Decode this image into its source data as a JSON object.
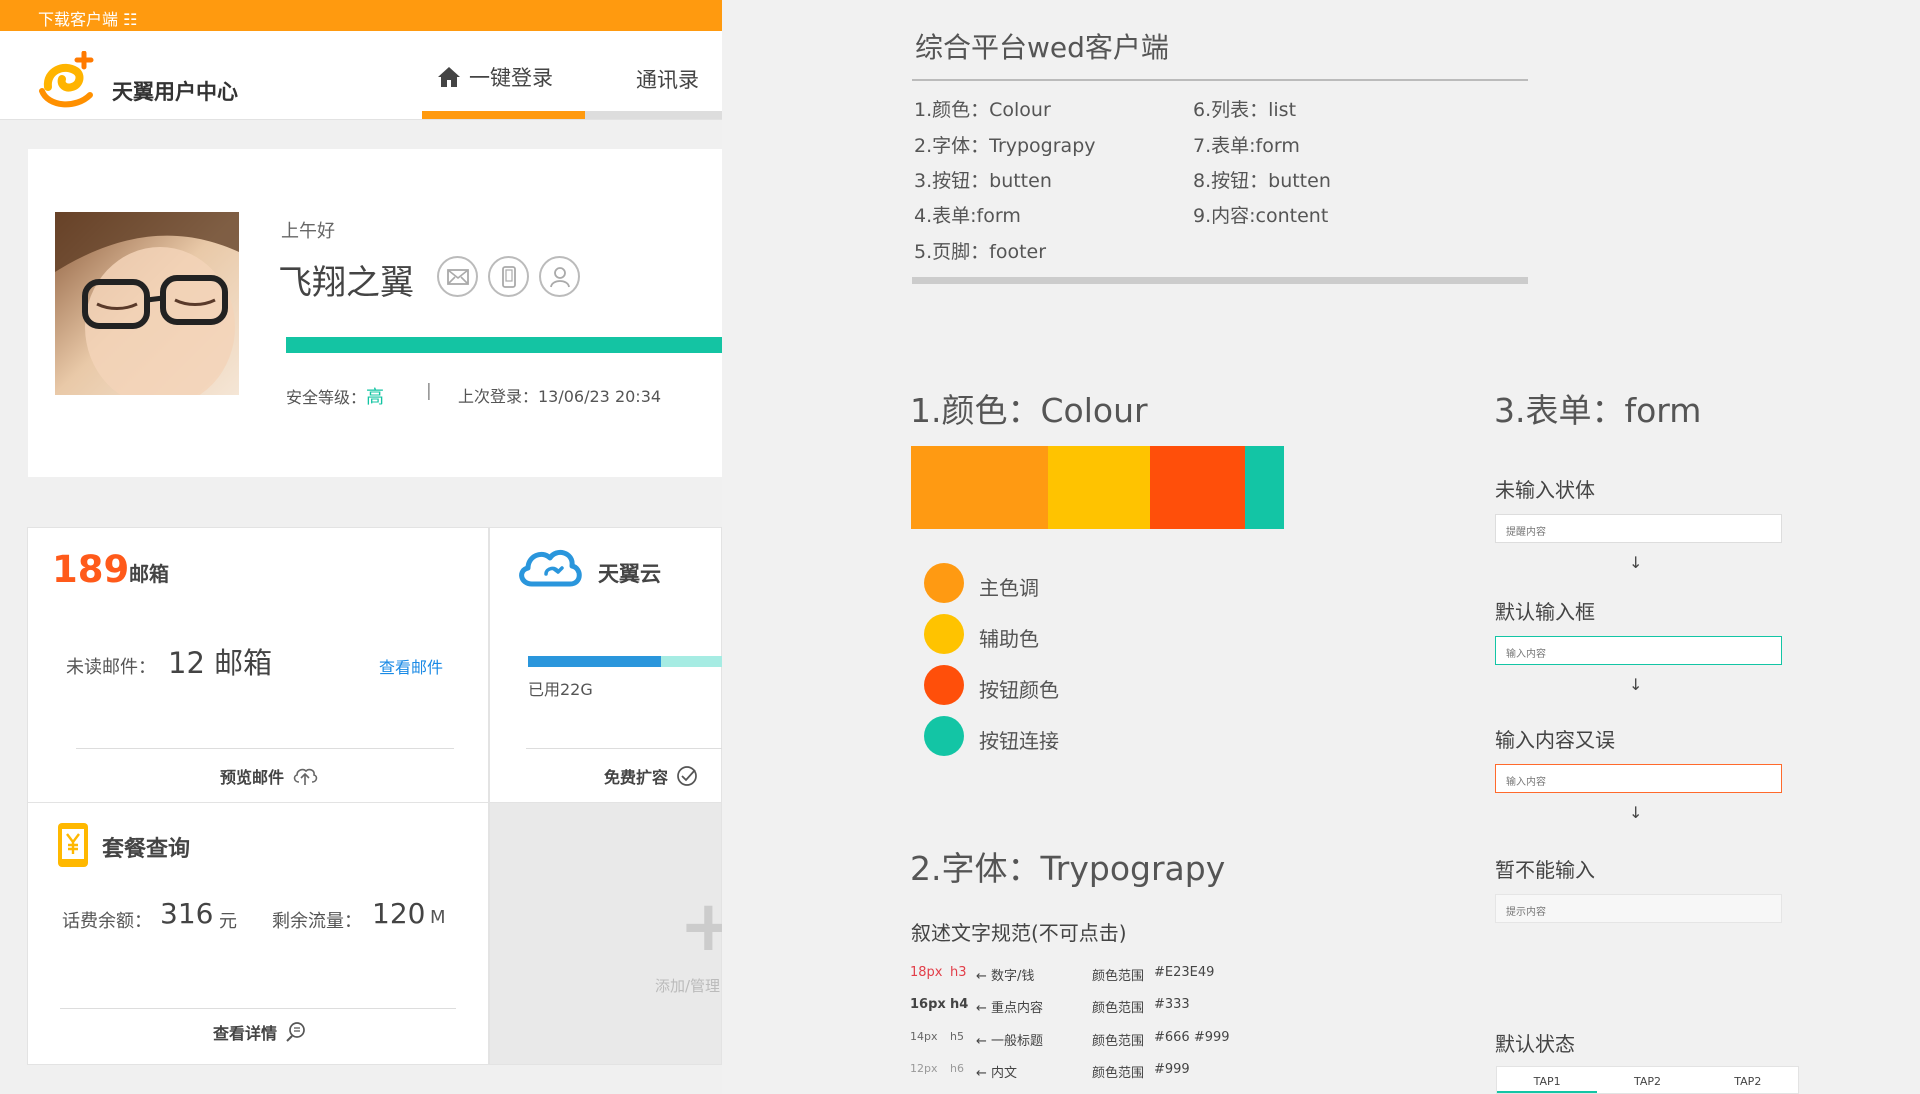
{
  "topbar": {
    "text": "下载客户端 ☷"
  },
  "header": {
    "logo_text": "天翼用户中心",
    "nav_login": "一键登录",
    "nav_contacts": "通讯录"
  },
  "profile": {
    "greeting": "上午好",
    "username": "飞翔之翼",
    "security_label": "安全等级：",
    "security_value": "高",
    "separator": "|",
    "last_login": "上次登录：13/06/23 20:34",
    "security_progress_percent": 100
  },
  "mail": {
    "brand_number": "189",
    "title": "邮箱",
    "unread_label": "未读邮件：",
    "unread_value": "12 邮箱",
    "view_link": "查看邮件",
    "preview_button": "预览邮件"
  },
  "cloud": {
    "title": "天翼云",
    "used_text": "已用22G",
    "used_fraction": 0.68,
    "expand_button": "免费扩容"
  },
  "package": {
    "title": "套餐查询",
    "balance_label": "话费余额：",
    "balance_value": "316",
    "balance_unit": "元",
    "flow_label": "剩余流量：",
    "flow_value": "120",
    "flow_unit": "M",
    "detail_button": "查看详情"
  },
  "add_card": {
    "label": "添加/管理"
  },
  "spec": {
    "title": "综合平台wed客户端",
    "toc_left": [
      "1.颜色：Colour",
      "2.字体：Trypograpy",
      "3.按钮：butten",
      "4.表单:form",
      "5.页脚：footer"
    ],
    "toc_right": [
      "6.列表：list",
      "7.表单:form",
      "8.按钮：butten",
      "9.内容:content"
    ],
    "colour_heading": "1.颜色：Colour",
    "colour_swatches": [
      "#ff9a12",
      "#ffc300",
      "#ff4f0a",
      "#13c5a5"
    ],
    "legend": [
      {
        "label": "主色调",
        "color": "#ff9a12"
      },
      {
        "label": "辅助色",
        "color": "#ffc300"
      },
      {
        "label": "按钮颜色",
        "color": "#ff4f0a"
      },
      {
        "label": "按钮连接",
        "color": "#13c5a5"
      }
    ],
    "type_heading": "2.字体：Trypograpy",
    "type_subtitle": "叙述文字规范(不可点击)",
    "type_rows": [
      {
        "size": "18px",
        "tag": "h3",
        "desc": "← 数字/钱",
        "range_label": "颜色范围",
        "colors": "#E23E49",
        "highlight": "#e23e49"
      },
      {
        "size": "16px",
        "tag": "h4",
        "desc": "← 重点内容",
        "range_label": "颜色范围",
        "colors": "#333",
        "highlight": "#333333"
      },
      {
        "size": "14px",
        "tag": "h5",
        "desc": "← 一般标题",
        "range_label": "颜色范围",
        "colors": "#666   #999",
        "highlight": "#666666"
      },
      {
        "size": "12px",
        "tag": "h6",
        "desc": "← 内文",
        "range_label": "颜色范围",
        "colors": "#999",
        "highlight": "#999999"
      }
    ],
    "form_heading": "3.表单：form",
    "form_states": [
      {
        "label": "未输入状体",
        "placeholder": "提醒内容",
        "border": "#dddddd"
      },
      {
        "label": "默认输入框",
        "placeholder": "输入内容",
        "border": "#13c5a5"
      },
      {
        "label": "输入内容又误",
        "placeholder": "输入内容",
        "border": "#ff6a2c"
      },
      {
        "label": "暂不能输入",
        "placeholder": "提示内容",
        "border": "#e5e5e5"
      }
    ],
    "arrow": "↓",
    "default_state_label": "默认状态",
    "tabs": [
      "TAP1",
      "TAP2",
      "TAP2"
    ]
  }
}
